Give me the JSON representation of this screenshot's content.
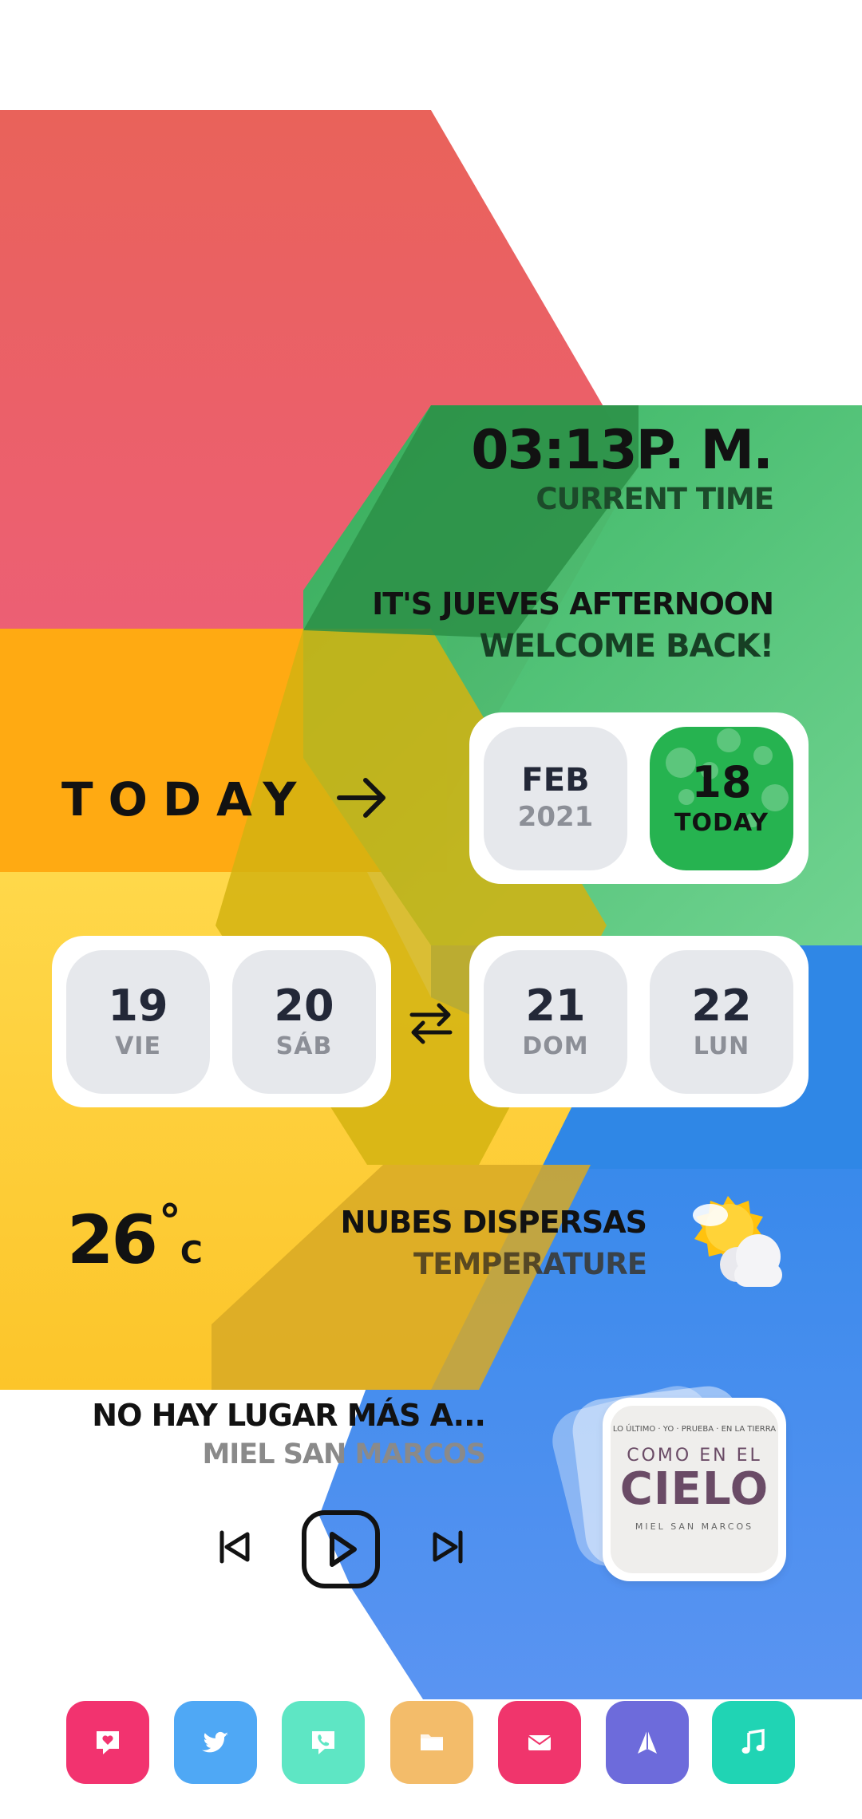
{
  "clock": {
    "time": "03:13P. M.",
    "label": "CURRENT TIME"
  },
  "greeting": {
    "line1": "IT'S JUEVES AFTERNOON",
    "line2": "WELCOME BACK!"
  },
  "today": {
    "label": "TODAY",
    "arrow_icon": "arrow-right-icon"
  },
  "date": {
    "month": "FEB",
    "year": "2021",
    "day": "18",
    "day_label": "TODAY"
  },
  "upcoming_left": [
    {
      "day": "19",
      "weekday": "VIE"
    },
    {
      "day": "20",
      "weekday": "SÁB"
    }
  ],
  "upcoming_right": [
    {
      "day": "21",
      "weekday": "DOM"
    },
    {
      "day": "22",
      "weekday": "LUN"
    }
  ],
  "weather": {
    "temp": "26",
    "degree": "°",
    "unit": "C",
    "condition": "NUBES DISPERSAS",
    "label": "TEMPERATURE",
    "icon": "partly-cloudy-icon"
  },
  "music": {
    "song": "NO HAY LUGAR MÁS A...",
    "artist": "MIEL SAN MARCOS",
    "album_top": "LO ÚLTIMO · YO · PRUEBA · EN LA TIERRA",
    "album_title_1": "COMO EN EL",
    "album_title_2": "CIELO",
    "album_artist": "MIEL SAN MARCOS"
  },
  "dock": [
    {
      "icon": "chat-heart-icon",
      "color": "#F2336F"
    },
    {
      "icon": "twitter-icon",
      "color": "#4FA8F5"
    },
    {
      "icon": "phone-icon",
      "color": "#5EE6C4"
    },
    {
      "icon": "folder-icon",
      "color": "#F3BC6A"
    },
    {
      "icon": "mail-icon",
      "color": "#F0356C"
    },
    {
      "icon": "paper-plane-icon",
      "color": "#6D6BDB"
    },
    {
      "icon": "music-note-icon",
      "color": "#20D4B4"
    }
  ]
}
